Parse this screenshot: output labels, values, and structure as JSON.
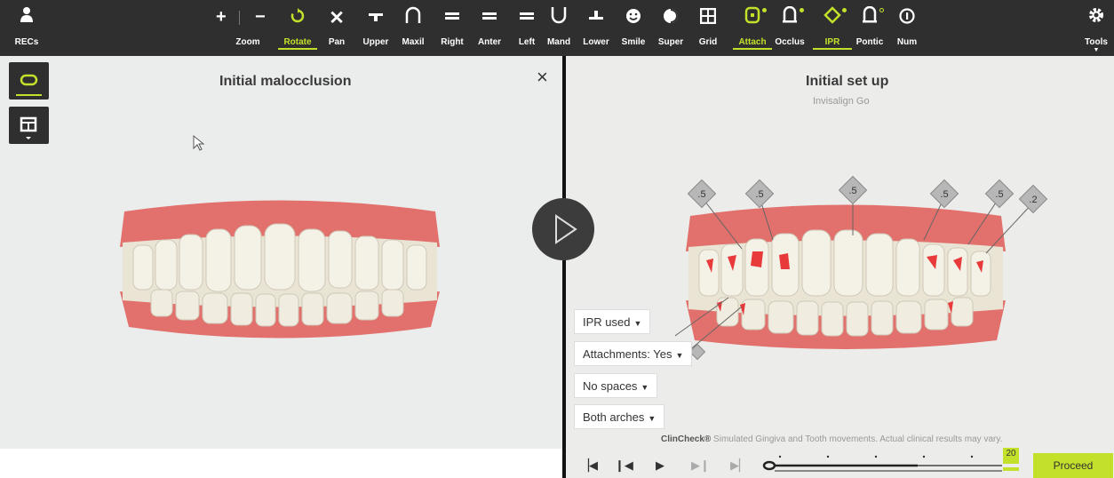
{
  "toolbar": {
    "recs": {
      "label": "RECs",
      "icon": "user-icon"
    },
    "tools": {
      "label": "Tools",
      "icon": "gear-icon"
    },
    "zoom_in_icon": "+",
    "zoom_out_icon": "−",
    "items": [
      {
        "label": "Zoom",
        "icon": "zoom-icon",
        "active": false
      },
      {
        "label": "Rotate",
        "icon": "rotate-icon",
        "active": true
      },
      {
        "label": "Pan",
        "icon": "pan-icon",
        "active": false
      },
      {
        "label": "Upper",
        "icon": "upper-icon",
        "active": false
      },
      {
        "label": "Maxil",
        "icon": "maxil-icon",
        "active": false
      },
      {
        "label": "Right",
        "icon": "right-icon",
        "active": false
      },
      {
        "label": "Anter",
        "icon": "anter-icon",
        "active": false
      },
      {
        "label": "Left",
        "icon": "left-icon",
        "active": false
      },
      {
        "label": "Mand",
        "icon": "mand-icon",
        "active": false
      },
      {
        "label": "Lower",
        "icon": "lower-icon",
        "active": false
      },
      {
        "label": "Smile",
        "icon": "smile-icon",
        "active": false
      },
      {
        "label": "Super",
        "icon": "super-icon",
        "active": false
      },
      {
        "label": "Grid",
        "icon": "grid-icon",
        "active": false
      },
      {
        "label": "Attach",
        "icon": "attach-icon",
        "active": true
      },
      {
        "label": "Occlus",
        "icon": "occlus-icon",
        "active": false
      },
      {
        "label": "IPR",
        "icon": "ipr-icon",
        "active": true
      },
      {
        "label": "Pontic",
        "icon": "pontic-icon",
        "active": false
      },
      {
        "label": "Num",
        "icon": "num-icon",
        "active": false
      }
    ]
  },
  "left_pane": {
    "title": "Initial malocclusion",
    "close_icon": "×"
  },
  "right_pane": {
    "title": "Initial set up",
    "subtitle": "Invisalign Go"
  },
  "ipr_labels": [
    ".5",
    ".5",
    ".5",
    ".5",
    ".5",
    ".2"
  ],
  "dropdowns": {
    "ipr": "IPR used",
    "attachments": "Attachments: Yes",
    "spaces": "No spaces",
    "arches": "Both arches"
  },
  "disclaimer": {
    "brand": "ClinCheck®",
    "text": " Simulated Gingiva and Tooth movements. Actual clinical results may vary."
  },
  "playback": {
    "stage_badge": "20",
    "proceed": "Proceed"
  },
  "colors": {
    "accent": "#c3e02a",
    "toolbar_bg": "#2f2f2f",
    "ipr_red": "#e83a3a"
  }
}
